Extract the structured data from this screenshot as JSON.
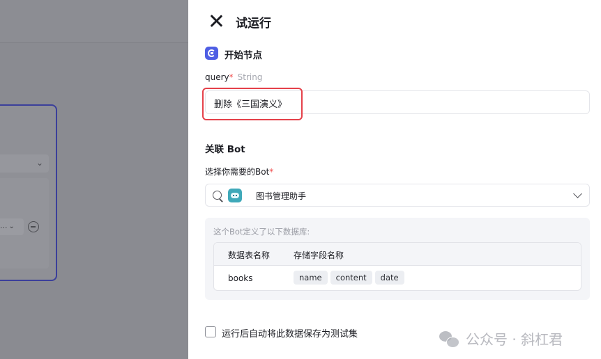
{
  "panel": {
    "title": "试运行"
  },
  "start_node": {
    "title": "开始节点",
    "field": {
      "name": "query",
      "required_mark": "*",
      "type": "String",
      "value": "删除《三国演义》"
    }
  },
  "bot_link": {
    "title": "关联 Bot",
    "select_label": "选择你需要的Bot",
    "required_mark": "*",
    "selected_bot": "图书管理助手",
    "db_note": "这个Bot定义了以下数据库:",
    "table": {
      "headers": [
        "数据表名称",
        "存储字段名称"
      ],
      "rows": [
        {
          "name": "books",
          "fields": [
            "name",
            "content",
            "date"
          ]
        }
      ]
    }
  },
  "save_option": {
    "label": "运行后自动将此数据保存为测试集",
    "checked": false
  },
  "watermark": {
    "text": "公众号 · 斜杠君"
  },
  "colors": {
    "accent": "#4e5ee4",
    "required": "#f04b4b",
    "highlight": "#e5414a",
    "node_border": "#3b3f9a"
  }
}
